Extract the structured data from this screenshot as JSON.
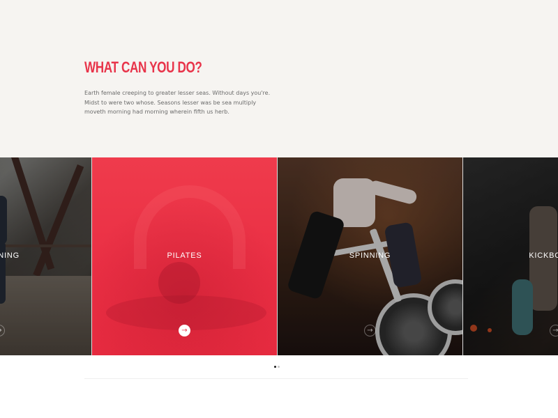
{
  "intro": {
    "title": "WHAT CAN YOU DO?",
    "text": "Earth female creeping to greater lesser seas. Without days you're. Midst to were two whose. Seasons lesser was be sea multiply moveth morning had morning wherein fifth us herb."
  },
  "slider": {
    "cards": [
      {
        "label": "TRAINING",
        "arrow_icon": "arrow-right-icon"
      },
      {
        "label": "PILATES",
        "arrow_icon": "arrow-right-icon",
        "active": true
      },
      {
        "label": "SPINNING",
        "arrow_icon": "arrow-right-icon"
      },
      {
        "label": "KICKBOXING",
        "arrow_icon": "arrow-right-icon"
      }
    ],
    "arrow_glyph": "→",
    "pagination": {
      "count": 2,
      "active_index": 0
    }
  },
  "colors": {
    "accent": "#e8344a",
    "intro_background": "#f6f4f1",
    "body_text": "#6b6b6b"
  }
}
